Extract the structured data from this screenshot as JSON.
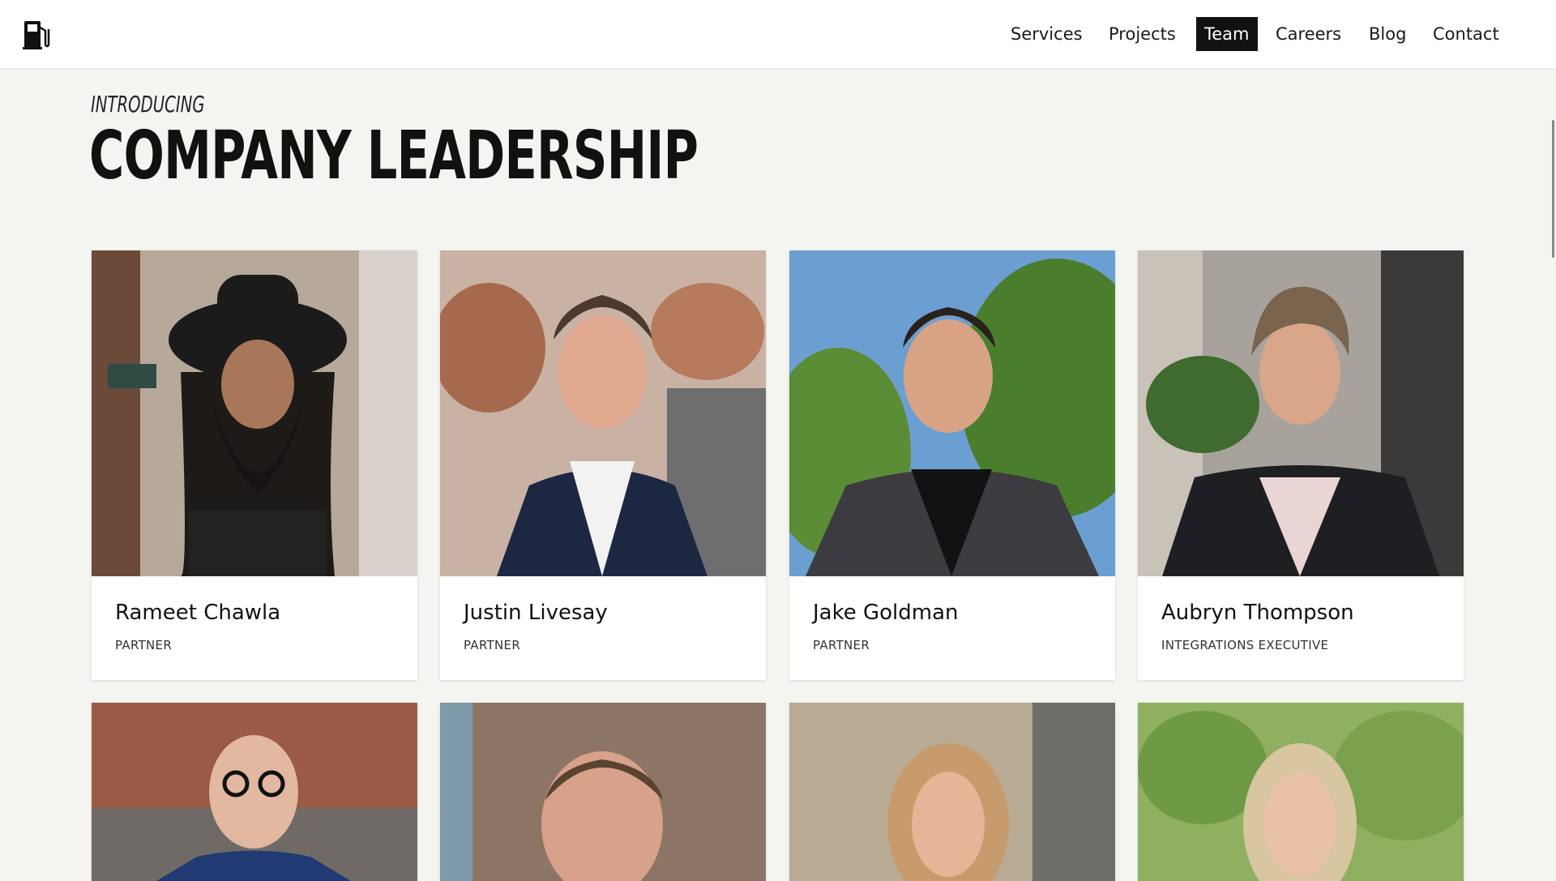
{
  "header": {
    "logo": "fuel-pump-icon",
    "nav": [
      "Services",
      "Projects",
      "Team",
      "Careers",
      "Blog",
      "Contact"
    ],
    "active": "Team"
  },
  "hero": {
    "kicker": "INTRODUCING",
    "title": "COMPANY LEADERSHIP"
  },
  "team": [
    {
      "name": "Rameet Chawla",
      "role": "PARTNER"
    },
    {
      "name": "Justin Livesay",
      "role": "PARTNER"
    },
    {
      "name": "Jake Goldman",
      "role": "PARTNER"
    },
    {
      "name": "Aubryn Thompson",
      "role": "INTEGRATIONS EXECUTIVE"
    }
  ],
  "colors": {
    "background": "#f4f4f1",
    "nav_active_bg": "#111111",
    "text": "#111111"
  }
}
